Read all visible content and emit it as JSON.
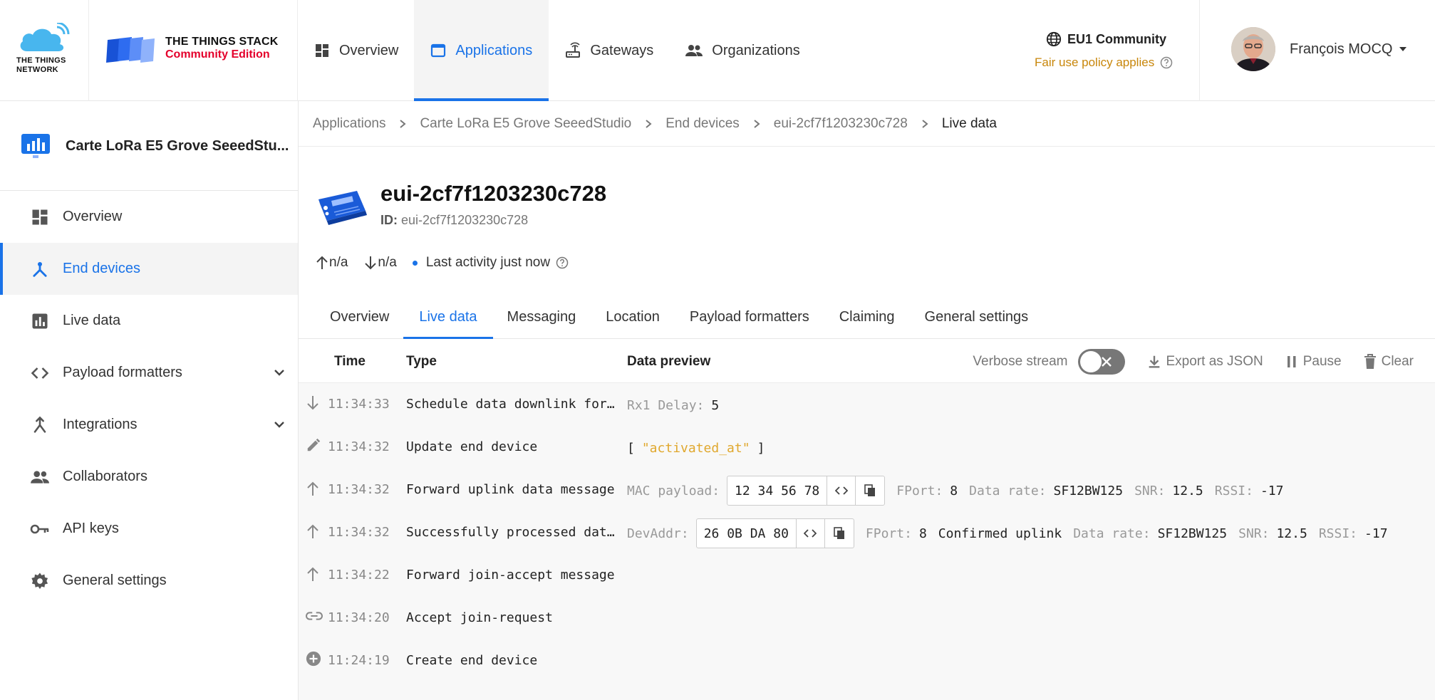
{
  "brand": {
    "ttn_line1": "THE THINGS",
    "ttn_line2": "NETWORK",
    "tts_line1": "THE THINGS STACK",
    "tts_line2": "Community Edition"
  },
  "topnav": {
    "items": [
      {
        "label": "Overview",
        "icon": "overview-icon"
      },
      {
        "label": "Applications",
        "icon": "applications-icon",
        "active": true
      },
      {
        "label": "Gateways",
        "icon": "gateway-icon"
      },
      {
        "label": "Organizations",
        "icon": "organizations-icon"
      }
    ]
  },
  "community": {
    "name": "EU1 Community",
    "fair_use": "Fair use policy applies"
  },
  "user": {
    "name": "François MOCQ"
  },
  "sidebar": {
    "app_name": "Carte LoRa E5 Grove SeeedStu...",
    "items": [
      {
        "label": "Overview",
        "icon": "overview-icon"
      },
      {
        "label": "End devices",
        "icon": "end-devices-icon",
        "active": true
      },
      {
        "label": "Live data",
        "icon": "live-data-icon"
      },
      {
        "label": "Payload formatters",
        "icon": "code-icon",
        "expandable": true
      },
      {
        "label": "Integrations",
        "icon": "integrations-icon",
        "expandable": true
      },
      {
        "label": "Collaborators",
        "icon": "collaborators-icon"
      },
      {
        "label": "API keys",
        "icon": "key-icon"
      },
      {
        "label": "General settings",
        "icon": "gear-icon"
      }
    ]
  },
  "breadcrumb": [
    "Applications",
    "Carte LoRa E5 Grove SeeedStudio",
    "End devices",
    "eui-2cf7f1203230c728",
    "Live data"
  ],
  "device": {
    "title": "eui-2cf7f1203230c728",
    "id_label": "ID:",
    "id_value": "eui-2cf7f1203230c728",
    "uplink": "n/a",
    "downlink": "n/a",
    "last_activity": "Last activity just now"
  },
  "tabs": [
    "Overview",
    "Live data",
    "Messaging",
    "Location",
    "Payload formatters",
    "Claiming",
    "General settings"
  ],
  "live": {
    "col_time": "Time",
    "col_type": "Type",
    "col_preview": "Data preview",
    "verbose_label": "Verbose stream",
    "verbose_on": false,
    "export_label": "Export as JSON",
    "pause_label": "Pause",
    "clear_label": "Clear",
    "rows": [
      {
        "icon": "arrow-down-icon",
        "time": "11:34:33",
        "type": "Schedule data downlink for transmission"
      },
      {
        "icon": "edit-icon",
        "time": "11:34:32",
        "type": "Update end device"
      },
      {
        "icon": "arrow-up-icon",
        "time": "11:34:32",
        "type": "Forward uplink data message"
      },
      {
        "icon": "arrow-up-icon",
        "time": "11:34:32",
        "type": "Successfully processed data message"
      },
      {
        "icon": "arrow-up-icon",
        "time": "11:34:22",
        "type": "Forward join-accept message"
      },
      {
        "icon": "link-icon",
        "time": "11:34:20",
        "type": "Accept join-request"
      },
      {
        "icon": "add-circle-icon",
        "time": "11:24:19",
        "type": "Create end device"
      }
    ],
    "preview": {
      "r0": {
        "l1": "Rx1 Delay:",
        "v1": "5"
      },
      "r1": {
        "open": "[",
        "str": "\"activated_at\"",
        "close": "]"
      },
      "r2": {
        "l1": "MAC payload:",
        "hex": "12 34 56 78",
        "l2": "FPort:",
        "v2": "8",
        "l3": "Data rate:",
        "v3": "SF12BW125",
        "l4": "SNR:",
        "v4": "12.5",
        "l5": "RSSI:",
        "v5": "-17"
      },
      "r3": {
        "l1": "DevAddr:",
        "hex": "26 0B DA 80",
        "l2": "FPort:",
        "v2": "8",
        "confirmed": "Confirmed uplink",
        "l3": "Data rate:",
        "v3": "SF12BW125",
        "l4": "SNR:",
        "v4": "12.5",
        "l5": "RSSI:",
        "v5": "-17"
      }
    }
  },
  "colors": {
    "accent": "#1a73e8",
    "brand_red": "#e4002b",
    "warning": "#c8860a"
  }
}
